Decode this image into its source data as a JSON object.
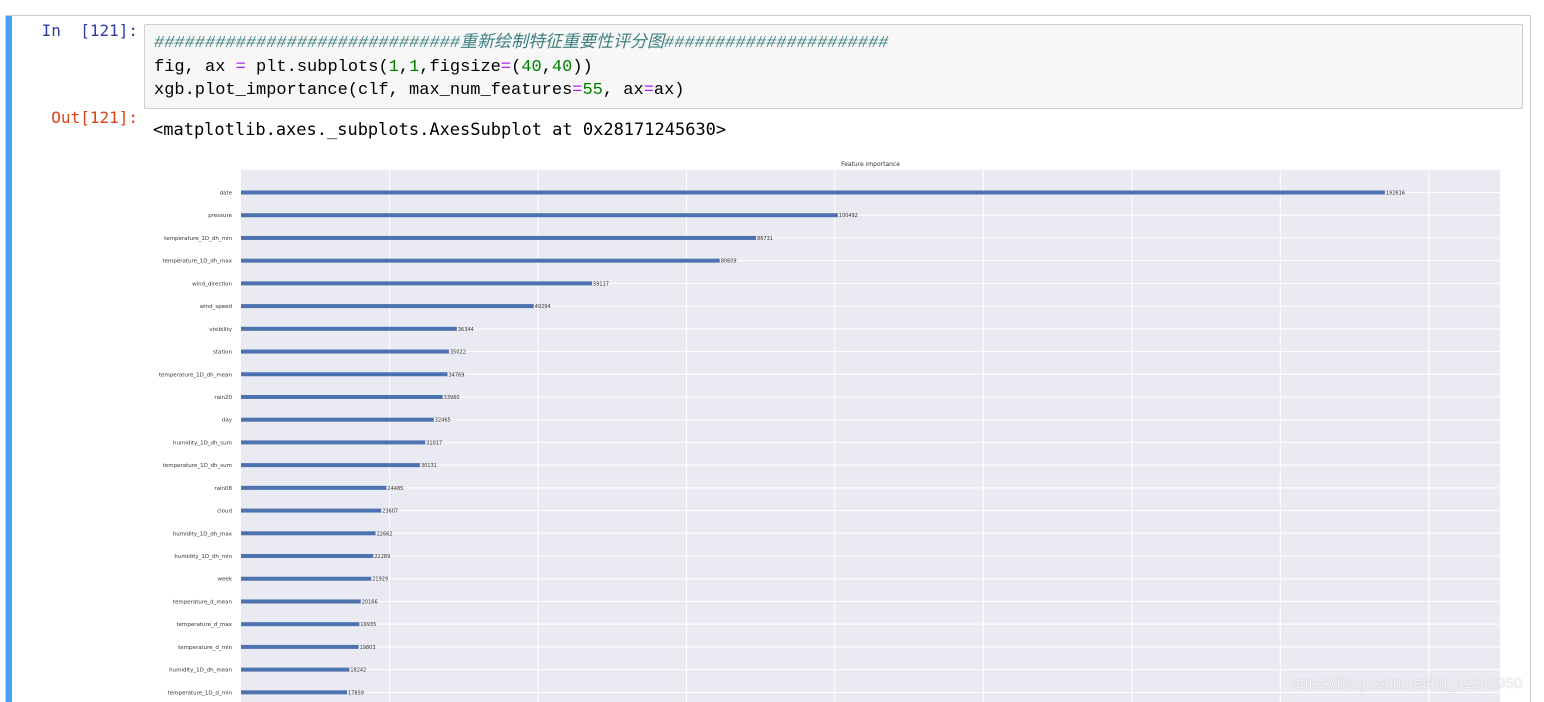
{
  "cell": {
    "in_prompt": "In  [121]:",
    "out_prompt": "Out[121]:",
    "code_comment": "##############################重新绘制特征重要性评分图######################",
    "code_line2": {
      "a": "fig, ax ",
      "eq": "=",
      "b": " plt.subplots(",
      "n1": "1",
      "c1": ",",
      "n2": "1",
      "c2": ",figsize",
      "eq2": "=",
      "p1": "(",
      "n3": "40",
      "c3": ",",
      "n4": "40",
      "p2": "))"
    },
    "code_line3": {
      "a": "xgb.plot_importance(clf, max_num_features",
      "eq": "=",
      "n": "55",
      "b": ", ax",
      "eq2": "=",
      "c": "ax)"
    },
    "output_text": "<matplotlib.axes._subplots.AxesSubplot at 0x28171245630>"
  },
  "watermark": "https://blog.csdn.net/qq_41940950",
  "colors": {
    "cell_bar": "#42a5f5",
    "bar": "#4c72b0",
    "plot_bg": "#eaeaf2",
    "grid": "#ffffff",
    "in_prompt": "#303f9f",
    "out_prompt": "#d84315"
  },
  "chart_data": {
    "type": "bar",
    "orientation": "horizontal",
    "title": "Feature importance",
    "xlim": [
      0,
      212000
    ],
    "grid": true,
    "categories": [
      "date",
      "pressure",
      "temperature_1D_dh_min",
      "temperature_1D_dh_max",
      "wind_direction",
      "wind_speed",
      "visibility",
      "station",
      "temperature_1D_dh_mean",
      "rain20",
      "day",
      "humidity_1D_dh_sum",
      "temperature_1D_dh_sum",
      "rain08",
      "cloud",
      "humidity_1D_dh_max",
      "humidity_1D_dh_min",
      "week",
      "temperature_d_mean",
      "temperature_d_max",
      "temperature_d_min",
      "humidity_1D_dh_mean",
      "temperature_1D_d_min"
    ],
    "values": [
      192616,
      100492,
      86731,
      80609,
      59117,
      49294,
      36344,
      35022,
      34769,
      33960,
      32465,
      31017,
      30131,
      24485,
      23607,
      22662,
      22289,
      21929,
      20166,
      19935,
      19803,
      18242,
      17859
    ]
  }
}
